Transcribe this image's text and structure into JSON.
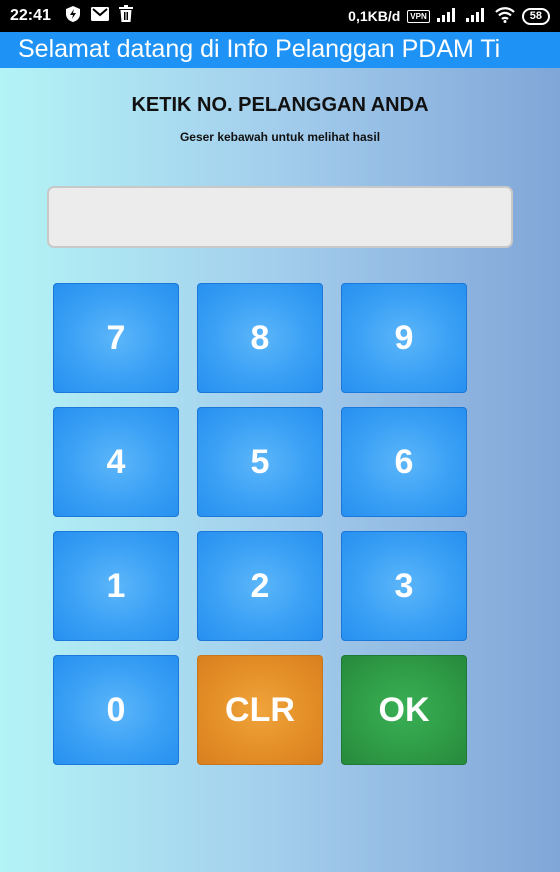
{
  "status_bar": {
    "time": "22:41",
    "left_icons": [
      "shield-icon",
      "mail-icon",
      "trash-icon"
    ],
    "data_rate": "0,1KB/d",
    "vpn_label": "VPN",
    "battery": "58"
  },
  "marquee": {
    "text": "Selamat datang di Info Pelanggan PDAM Ti"
  },
  "header": {
    "title": "KETIK NO. PELANGGAN ANDA",
    "subtitle": "Geser kebawah untuk melihat hasil"
  },
  "input": {
    "value": "",
    "placeholder": ""
  },
  "keypad": {
    "k7": "7",
    "k8": "8",
    "k9": "9",
    "k4": "4",
    "k5": "5",
    "k6": "6",
    "k1": "1",
    "k2": "2",
    "k3": "3",
    "k0": "0",
    "clr": "CLR",
    "ok": "OK"
  },
  "colors": {
    "marquee_bg": "#1f93f5",
    "key_blue": "#3aa0f5",
    "key_orange": "#e48f28",
    "key_green": "#2f9c47"
  }
}
